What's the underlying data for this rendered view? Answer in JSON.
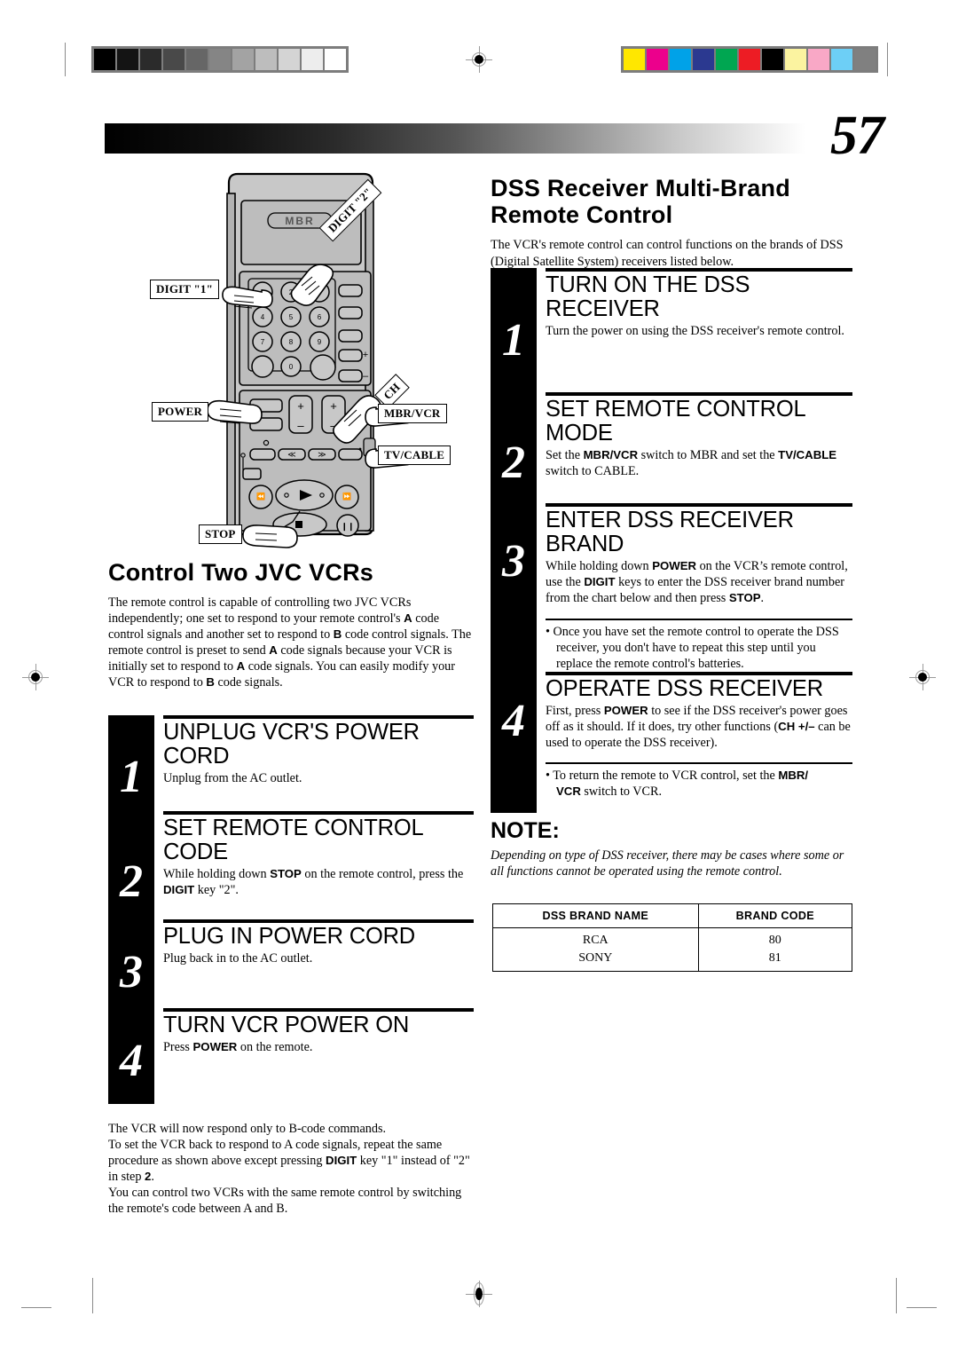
{
  "page": {
    "number": "57",
    "calibration": {
      "gray_wedge": [
        "#000000",
        "#141414",
        "#2b2b2b",
        "#494949",
        "#666666",
        "#858585",
        "#a3a3a3",
        "#bdbdbd",
        "#d4d4d4",
        "#ededed",
        "#ffffff"
      ],
      "color_bar": [
        "#ffe700",
        "#e9views",
        "#00a2e8",
        "#2b3990",
        "#00a651",
        "#ed1c24",
        "#000000",
        "#fbf3a0",
        "#f9a8c6",
        "#6dcff6",
        "#808080"
      ],
      "color_bar_fixed": [
        "#ffe700",
        "#ec008c",
        "#00a2e8",
        "#2b3990",
        "#00a651",
        "#ed1c24",
        "#000000",
        "#fbf3a0",
        "#f9a8c6",
        "#6dcff6",
        "#808080"
      ]
    }
  },
  "illustration": {
    "device_label": "MBR",
    "keypad": [
      "1",
      "2",
      "3",
      "4",
      "5",
      "6",
      "7",
      "8",
      "9",
      "0"
    ],
    "callouts": [
      {
        "id": "digit-2",
        "label": "DIGIT \"2\""
      },
      {
        "id": "digit-1",
        "label": "DIGIT \"1\""
      },
      {
        "id": "ch",
        "label": "CH"
      },
      {
        "id": "power",
        "label": "POWER"
      },
      {
        "id": "mbr-vcr",
        "label": "MBR/VCR"
      },
      {
        "id": "tv-cable",
        "label": "TV/CABLE"
      },
      {
        "id": "stop",
        "label": "STOP"
      }
    ]
  },
  "left_column": {
    "section_title": "Control Two JVC VCRs",
    "intro": "The remote control is capable of controlling two JVC VCRs independently; one set to respond to your remote control's A code control signals and another set to respond to B code control signals. The remote control is preset to send A code signals because your VCR is initially set to respond to A code signals. You can easily modify your VCR to respond to B code signals.",
    "steps": [
      {
        "number": "1",
        "heading": "UNPLUG VCR'S POWER CORD",
        "body": "Unplug from the AC outlet."
      },
      {
        "number": "2",
        "heading": "SET REMOTE CONTROL CODE",
        "body": "While holding down STOP on the remote control, press the DIGIT key \"2\"."
      },
      {
        "number": "3",
        "heading": "PLUG IN POWER CORD",
        "body": "Plug back in to the AC outlet."
      },
      {
        "number": "4",
        "heading": "TURN VCR POWER ON",
        "body": "Press POWER on the remote."
      }
    ],
    "closing": [
      "The VCR will now respond only to B-code commands.",
      "To set the VCR back to respond to A code signals, repeat the same procedure as shown above except pressing DIGIT key \"1\" instead of \"2\" in step 2.",
      "You can control two VCRs with the same remote control by switching the remote's code between A and B."
    ]
  },
  "right_column": {
    "section_title_line1": "DSS Receiver Multi-Brand",
    "section_title_line2": "Remote Control",
    "intro": "The VCR's remote control can control functions on the brands of DSS (Digital Satellite System) receivers listed below.",
    "steps": [
      {
        "number": "1",
        "heading": "TURN ON THE DSS RECEIVER",
        "body": "Turn the power on using the DSS receiver's remote control."
      },
      {
        "number": "2",
        "heading": "SET REMOTE CONTROL MODE",
        "body": "Set the MBR/VCR switch to MBR and set the TV/CABLE switch to CABLE."
      },
      {
        "number": "3",
        "heading": "ENTER DSS RECEIVER BRAND",
        "body": "While holding down POWER on the VCR's remote control, use the DIGIT keys to enter the DSS receiver brand number from the chart below and then press STOP.",
        "bullet": "Once you have set the remote control to operate the DSS receiver, you don't have to repeat this step until you replace the remote control's batteries."
      },
      {
        "number": "4",
        "heading": "OPERATE DSS RECEIVER",
        "body": "First, press POWER to see if the DSS receiver's power goes off as it should. If it does, try other functions (CH +/– can be used to operate the DSS receiver).",
        "bullet": "To return the remote to VCR control, set the MBR/VCR switch to VCR."
      }
    ],
    "note": {
      "heading": "NOTE:",
      "body": "Depending on type of DSS receiver, there may be cases where some or all functions cannot be operated using the remote control."
    },
    "table": {
      "headers": [
        "DSS BRAND NAME",
        "BRAND CODE"
      ],
      "rows": [
        [
          "RCA",
          "80"
        ],
        [
          "SONY",
          "81"
        ]
      ]
    }
  }
}
